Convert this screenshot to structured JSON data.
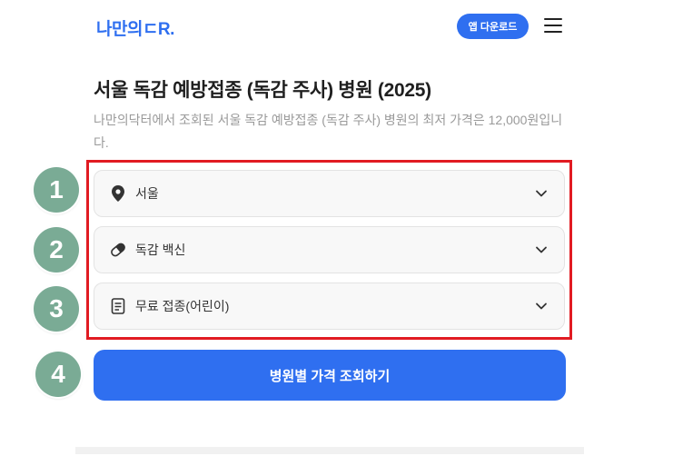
{
  "header": {
    "logo_text": "나만의",
    "logo_suffix": "ㄷR.",
    "app_button": "앱 다운로드"
  },
  "page": {
    "title": "서울 독감 예방접종 (독감 주사) 병원 (2025)",
    "description": "나만의닥터에서 조회된 서울 독감 예방접종 (독감 주사) 병원의 최저 가격은 12,000원입니다."
  },
  "selectors": {
    "region": "서울",
    "vaccine": "독감 백신",
    "type": "무료 접종(어린이)"
  },
  "markers": [
    "1",
    "2",
    "3",
    "4"
  ],
  "cta_label": "병원별 가격 조회하기",
  "colors": {
    "brand": "#2f6ff0",
    "highlight_border": "#e11b22",
    "marker": "#7aab95"
  }
}
